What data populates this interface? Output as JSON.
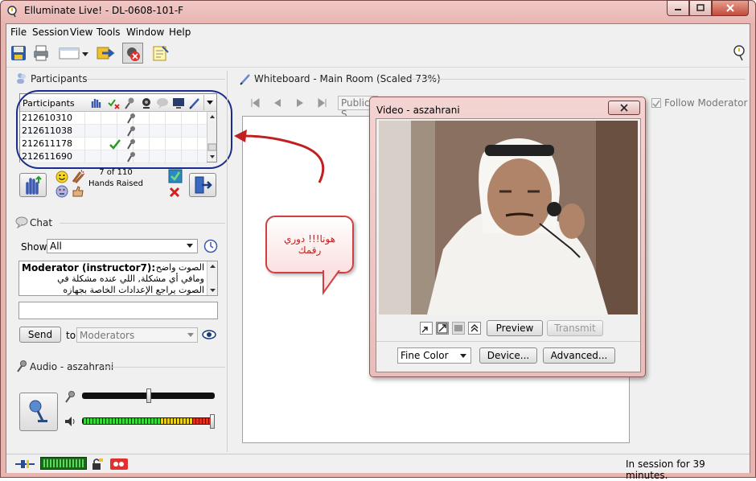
{
  "window": {
    "title": "Elluminate Live! - DL-0608-101-F"
  },
  "menu": [
    "File",
    "Session",
    "View",
    "Tools",
    "Window",
    "Help"
  ],
  "participants": {
    "heading": "Participants",
    "column_header": "Participants",
    "rows": [
      {
        "id": "212610310",
        "hand": false
      },
      {
        "id": "212611038",
        "hand": false
      },
      {
        "id": "212611178",
        "hand": true
      },
      {
        "id": "212611690",
        "hand": false
      }
    ],
    "hands_count": "7 of 110",
    "hands_label": "Hands Raised"
  },
  "chat": {
    "heading": "Chat",
    "show_label": "Show",
    "show_value": "All",
    "message_sender": "Moderator (instructor7):",
    "message_line1": "الصوت واضح",
    "message_line2": "ومافي أي مشكلة, اللي عنده مشكلة في",
    "message_line3": "الصوت يراجع الإعدادات الخاصة بجهازه",
    "send_label": "Send",
    "to_label": "to",
    "to_value": "Moderators"
  },
  "audio": {
    "heading": "Audio - aszahrani",
    "mic_level": 0.5,
    "speaker_level": 1.0
  },
  "whiteboard": {
    "heading": "Whiteboard - Main Room (Scaled 73%)",
    "room_select": "Public S",
    "follow_moderator": "Follow Moderator"
  },
  "video": {
    "title": "Video - aszahrani",
    "preview_label": "Preview",
    "transmit_label": "Transmit",
    "color_value": "Fine Color",
    "device_label": "Device...",
    "advanced_label": "Advanced..."
  },
  "annotation": {
    "line1": "هونا!!! دوري",
    "line2": "رقمك"
  },
  "status": {
    "session_text": "In session for 39 minutes."
  },
  "colors": {
    "frame": "#e8b4b0",
    "oval": "#1a2c8c",
    "arrow": "#c02020",
    "accent_green": "#2a9a2a"
  }
}
